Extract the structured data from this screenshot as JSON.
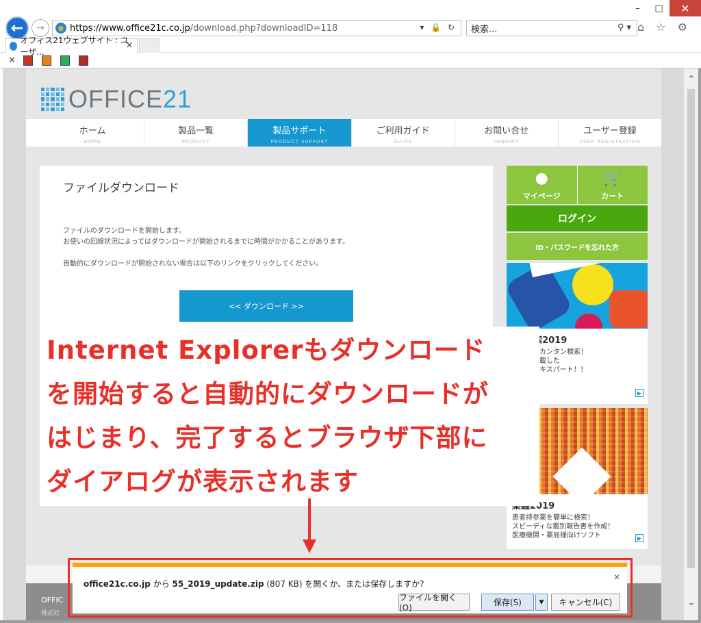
{
  "browser": {
    "window_controls": {
      "minimize": "–",
      "maximize": "□",
      "close": "✕"
    },
    "back_glyph": "←",
    "forward_glyph": "→",
    "url_host": "https://www.office21c.co.jp",
    "url_path": "/download.php?downloadID=118",
    "url_tools": "▾ 🔒 ↻",
    "search_placeholder": "検索...",
    "search_tools": "⚲ ▾",
    "right_icons": "⌂ ☆ ⚙",
    "tab_title": "オフィス21ウェブサイト : ユーザ...",
    "tab_close": "✕",
    "favbar_close": "✕"
  },
  "site": {
    "logo_text": "OFFICE",
    "logo_num": "21",
    "nav": [
      {
        "jp": "ホーム",
        "en": "HOME"
      },
      {
        "jp": "製品一覧",
        "en": "PRODUCT"
      },
      {
        "jp": "製品サポート",
        "en": "PRODUCT SUPPORT"
      },
      {
        "jp": "ご利用ガイド",
        "en": "GUIDE"
      },
      {
        "jp": "お問い合せ",
        "en": "INQUIRY"
      },
      {
        "jp": "ユーザー登録",
        "en": "USER REGISTRATION"
      }
    ],
    "main": {
      "title": "ファイルダウンロード",
      "p1": "ファイルのダウンロードを開始します。",
      "p2": "お使いの回線状況によってはダウンロードが開始されるまでに時間がかかることがあります。",
      "p3": "自動的にダウンロードが開始されない場合は以下のリンクをクリックしてください。",
      "download_button": "<< ダウンロード >>"
    },
    "sidebar": {
      "mypage": "マイページ",
      "cart": "カート",
      "login": "ログイン",
      "forgot": "ID・パスワードを忘れた方",
      "ad1_title": "55検索2019",
      "ad1_desc": [
        "れた薬をカンタン検索！",
        "機能を搭載した",
        "素の超エキスパート！！"
      ],
      "ad2_title": "薬鑑2019",
      "ad2_desc": [
        "患者持参薬を簡単に検索！",
        "スピーディな鑑別報告書を作成！",
        "医療機関・薬局様向けソフト"
      ],
      "play_glyph": "▶"
    },
    "footer": {
      "line1": "OFFIC",
      "line2": "株式社"
    }
  },
  "annotation": {
    "lines": [
      "Internet Explorerもダウンロード",
      "を開始すると自動的にダウンロードが",
      "はじまり、完了するとブラウザ下部に",
      "ダイアログが表示されます"
    ],
    "color": "#e8302a"
  },
  "download_bar": {
    "host": "office21c.co.jp",
    "from": " から ",
    "filename": "55_2019_update.zip",
    "size": " (807 KB) ",
    "question": "を開くか、または保存しますか?",
    "open_button": "ファイルを開く(O)",
    "save_button": "保存(S)",
    "save_menu_glyph": "▼",
    "cancel_button": "キャンセル(C)",
    "close_glyph": "✕"
  }
}
